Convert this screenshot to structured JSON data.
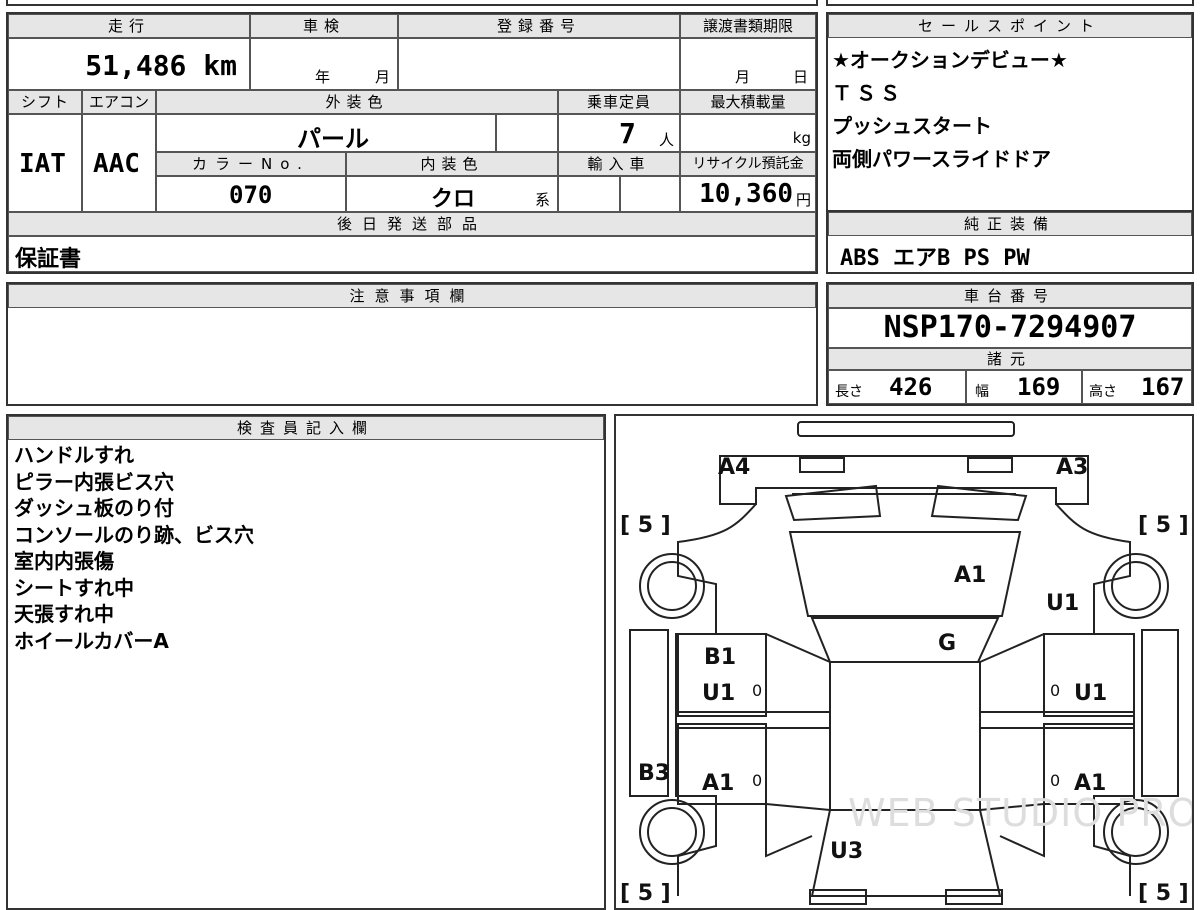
{
  "mileage": {
    "header": "走行",
    "value": "51,486",
    "unit": "km"
  },
  "inspection": {
    "header": "車検",
    "year_label": "年",
    "month_label": "月"
  },
  "registration": {
    "header": "登録番号"
  },
  "transfer": {
    "header": "譲渡書類期限",
    "month_label": "月",
    "day_label": "日"
  },
  "shift": {
    "header": "シフト",
    "value": "IAT"
  },
  "aircon": {
    "header": "エアコン",
    "value": "AAC"
  },
  "exterior_color": {
    "header": "外装色",
    "value": "パール"
  },
  "capacity": {
    "header": "乗車定員",
    "value": "7",
    "unit": "人"
  },
  "max_load": {
    "header": "最大積載量",
    "unit": "kg"
  },
  "color_no": {
    "header": "カラーNo.",
    "value": "070"
  },
  "interior_color": {
    "header": "内装色",
    "value": "クロ",
    "suffix": "系"
  },
  "import": {
    "header": "輸入車"
  },
  "recycle": {
    "header": "リサイクル預託金",
    "value": "10,360",
    "unit": "円"
  },
  "later_parts": {
    "header": "後日発送部品",
    "value": "保証書"
  },
  "sales_points": {
    "header": "セールスポイント",
    "items": [
      "★オークションデビュー★",
      "ＴＳＳ",
      "プッシュスタート",
      "両側パワースライドドア"
    ]
  },
  "equipment": {
    "header": "純正装備",
    "value": "ABS エアB PS PW"
  },
  "notes": {
    "header": "注意事項欄"
  },
  "chassis": {
    "header": "車台番号",
    "value": "NSP170-7294907"
  },
  "specs": {
    "header": "諸元",
    "length_label": "長さ",
    "length": "426",
    "width_label": "幅",
    "width": "169",
    "height_label": "高さ",
    "height": "167"
  },
  "inspector": {
    "header": "検査員記入欄",
    "lines": [
      "ハンドルすれ",
      "ピラー内張ビス穴",
      "ダッシュ板のり付",
      "コンソールのり跡、ビス穴",
      "室内内張傷",
      "シートすれ中",
      "天張すれ中",
      "ホイールカバーA"
    ]
  },
  "diagram": {
    "tl": "A4",
    "tr": "A3",
    "windshield": "A1",
    "hood": "G",
    "right_front": "U1",
    "left_front_door": "B1",
    "left_front_door2": "U1",
    "right_front_door": "U1",
    "left_rear_quarter": "B3",
    "left_rear_door": "A1",
    "right_rear_door": "A1",
    "rear": "U3",
    "tire_fl": "[ 5 ]",
    "tire_fr": "[ 5 ]",
    "tire_rl": "[ 5 ]",
    "tire_rr": "[ 5 ]",
    "zero": "0",
    "watermark": "WEB STUDIO PRO"
  }
}
